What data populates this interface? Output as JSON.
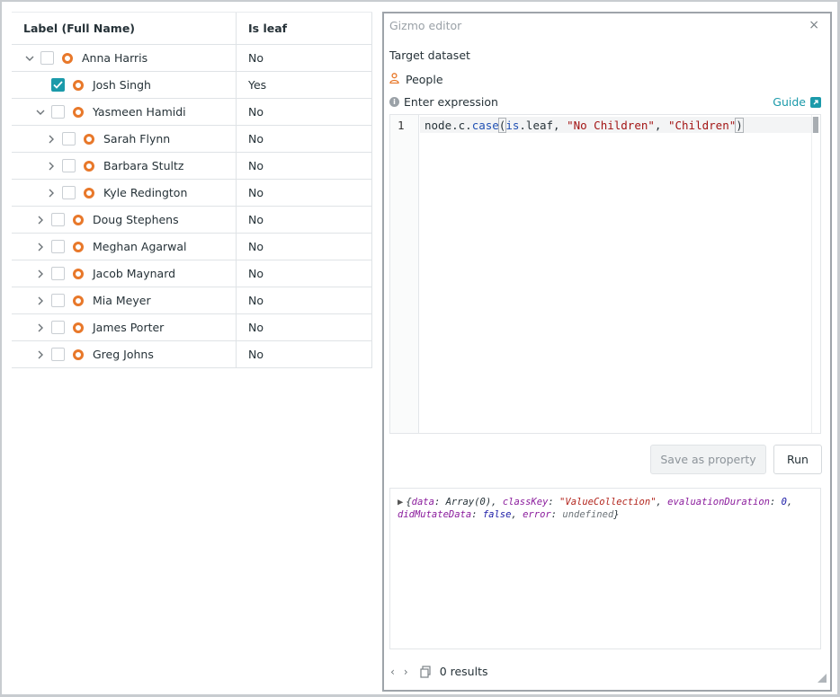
{
  "grid": {
    "headers": {
      "label": "Label (Full Name)",
      "is_leaf": "Is leaf"
    },
    "rows": [
      {
        "label": "Anna Harris",
        "is_leaf": "No",
        "expanded": true,
        "level": 0,
        "checked": false
      },
      {
        "label": "Josh Singh",
        "is_leaf": "Yes",
        "expanded": null,
        "level": 1,
        "checked": true
      },
      {
        "label": "Yasmeen Hamidi",
        "is_leaf": "No",
        "expanded": true,
        "level": 1,
        "checked": false
      },
      {
        "label": "Sarah Flynn",
        "is_leaf": "No",
        "expanded": false,
        "level": 2,
        "checked": false
      },
      {
        "label": "Barbara Stultz",
        "is_leaf": "No",
        "expanded": false,
        "level": 2,
        "checked": false
      },
      {
        "label": "Kyle Redington",
        "is_leaf": "No",
        "expanded": false,
        "level": 2,
        "checked": false
      },
      {
        "label": "Doug Stephens",
        "is_leaf": "No",
        "expanded": false,
        "level": 1,
        "checked": false
      },
      {
        "label": "Meghan Agarwal",
        "is_leaf": "No",
        "expanded": false,
        "level": 1,
        "checked": false
      },
      {
        "label": "Jacob Maynard",
        "is_leaf": "No",
        "expanded": false,
        "level": 1,
        "checked": false
      },
      {
        "label": "Mia Meyer",
        "is_leaf": "No",
        "expanded": false,
        "level": 1,
        "checked": false
      },
      {
        "label": "James Porter",
        "is_leaf": "No",
        "expanded": false,
        "level": 1,
        "checked": false
      },
      {
        "label": "Greg Johns",
        "is_leaf": "No",
        "expanded": false,
        "level": 1,
        "checked": false
      }
    ]
  },
  "editor": {
    "title": "Gizmo editor",
    "close_glyph": "×",
    "target_label": "Target dataset",
    "target_value": "People",
    "expression_label": "Enter expression",
    "guide_label": "Guide",
    "line_number": "1",
    "code": {
      "t1": "node.c.",
      "t2": "case",
      "t3": "(",
      "t4": "is",
      "t5": ".leaf, ",
      "t6": "\"No Children\"",
      "t7": ", ",
      "t8": "\"Children\"",
      "t9": ")"
    },
    "save_button": "Save as property",
    "run_button": "Run",
    "console": {
      "arrow": "▶",
      "p1": "{",
      "k_data": "data",
      "v_data": ": Array(0), ",
      "k_classKey": "classKey",
      "sep1": ": ",
      "v_classKey": "\"ValueCollection\"",
      "sep2": ", ",
      "k_duration": "evaluationDuration",
      "sep3": ": ",
      "v_duration": "0",
      "sep4": ",",
      "k_mutate": "didMutateData",
      "sep5": ": ",
      "v_mutate": "false",
      "sep6": ", ",
      "k_error": "error",
      "sep7": ": ",
      "v_error": "undefined",
      "p2": "}"
    },
    "footer_braces": "‹ ›",
    "results_text": "0 results"
  },
  "colors": {
    "accent": "#1b9aaa",
    "node_icon": "#e8782a",
    "person_icon": "#e8782a"
  },
  "icons": {
    "expand": "chevron-right-icon",
    "collapse": "chevron-down-icon",
    "node": "node-circle-icon",
    "person": "person-icon",
    "info": "info-icon",
    "external": "external-link-icon",
    "copy": "copy-icon",
    "resize": "resize-handle-icon"
  }
}
